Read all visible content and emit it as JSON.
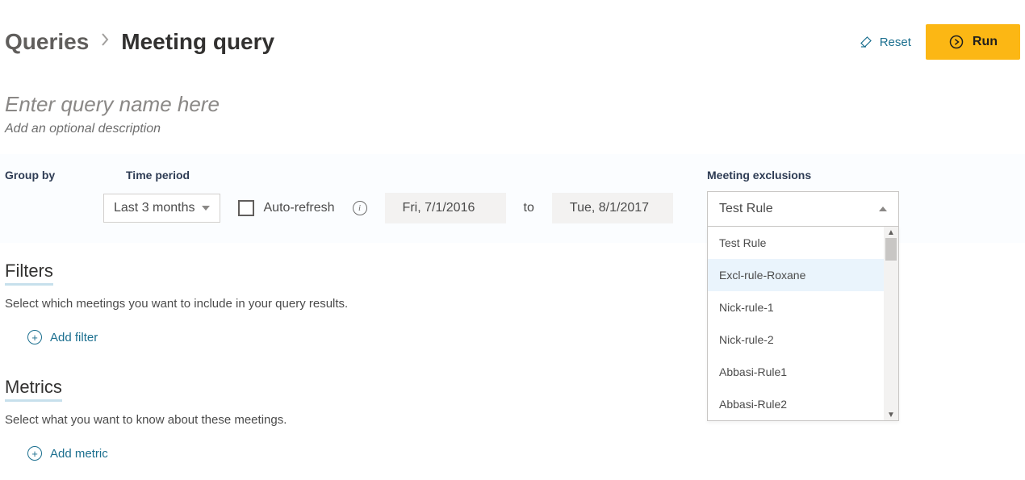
{
  "breadcrumb": {
    "root": "Queries",
    "leaf": "Meeting query"
  },
  "actions": {
    "reset": "Reset",
    "run": "Run"
  },
  "title": {
    "name_placeholder": "Enter query name here",
    "desc_placeholder": "Add an optional description"
  },
  "band": {
    "groupby_label": "Group by",
    "timeperiod_label": "Time period",
    "timeperiod_value": "Last 3 months",
    "autorefresh_label": "Auto-refresh",
    "date_from": "Fri, 7/1/2016",
    "to_label": "to",
    "date_to": "Tue, 8/1/2017",
    "excl_label": "Meeting exclusions",
    "excl_selected": "Test Rule",
    "excl_options": [
      "Test Rule",
      "Excl-rule-Roxane",
      "Nick-rule-1",
      "Nick-rule-2",
      "Abbasi-Rule1",
      "Abbasi-Rule2"
    ]
  },
  "filters": {
    "title": "Filters",
    "desc": "Select which meetings you want to include in your query results.",
    "add": "Add filter"
  },
  "metrics": {
    "title": "Metrics",
    "desc": "Select what you want to know about these meetings.",
    "add": "Add metric"
  }
}
